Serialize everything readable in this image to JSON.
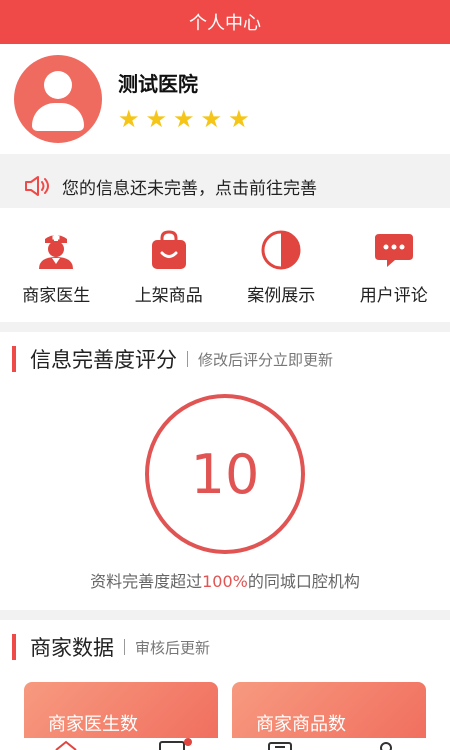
{
  "header": {
    "title": "个人中心"
  },
  "profile": {
    "name": "测试医院",
    "rating": 5
  },
  "notice": {
    "text": "您的信息还未完善，点击前往完善"
  },
  "quick_actions": [
    {
      "label": "商家医生",
      "icon": "doctor-icon"
    },
    {
      "label": "上架商品",
      "icon": "shopping-bag-icon"
    },
    {
      "label": "案例展示",
      "icon": "contrast-circle-icon"
    },
    {
      "label": "用户评论",
      "icon": "comment-bubble-icon"
    }
  ],
  "score_section": {
    "title": "信息完善度评分",
    "subtitle": "修改后评分立即更新",
    "score": "10",
    "desc_prefix": "资料完善度超过",
    "desc_percent": "100%",
    "desc_suffix": "的同城口腔机构"
  },
  "merchant_section": {
    "title": "商家数据",
    "subtitle": "审核后更新",
    "cards": [
      {
        "label": "商家医生数"
      },
      {
        "label": "商家商品数"
      }
    ]
  },
  "colors": {
    "accent": "#ef4a48",
    "star": "#f5c518"
  }
}
